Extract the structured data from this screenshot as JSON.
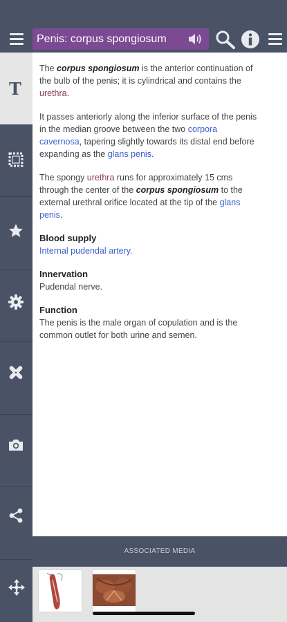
{
  "header": {
    "title": "Penis: corpus spongiosum"
  },
  "sidebar": {
    "items": [
      {
        "name": "text",
        "icon": "text-icon",
        "active": true
      },
      {
        "name": "images",
        "icon": "stamp-frame-icon",
        "active": false
      },
      {
        "name": "favorites",
        "icon": "star-icon",
        "active": false
      },
      {
        "name": "settings",
        "icon": "gear-icon",
        "active": false
      },
      {
        "name": "tools",
        "icon": "bandage-icon",
        "active": false
      },
      {
        "name": "camera",
        "icon": "camera-icon",
        "active": false
      },
      {
        "name": "share",
        "icon": "share-icon",
        "active": false
      },
      {
        "name": "move",
        "icon": "move-arrows-icon",
        "active": false
      }
    ],
    "text_glyph": "T"
  },
  "content": {
    "p1": {
      "a": "The ",
      "kw": "corpus spongiosum",
      "b": " is the anterior continuation of the bulb of the penis; it is cylindrical and contains the ",
      "link": "urethra",
      "c": "."
    },
    "p2": {
      "a": "It passes anteriorly along the inferior surface of the penis in the median groove between the two ",
      "link1": "corpora cavernosa",
      "b": ", tapering slightly towards its distal end before expanding as the ",
      "link2": "glans penis",
      "c": "."
    },
    "p3": {
      "a": "The spongy ",
      "link1": "urethra",
      "b": " runs for approximately 15 cms through the center of the ",
      "kw": "corpus spongiosum",
      "c": " to the external urethral orifice located at the tip of the ",
      "link2": "glans penis",
      "d": "."
    },
    "blood_supply": {
      "heading": "Blood supply",
      "link": "Internal pudendal artery",
      "end": "."
    },
    "innervation": {
      "heading": "Innervation",
      "text": "Pudendal nerve."
    },
    "function": {
      "heading": "Function",
      "text": "The penis is the male organ of copulation and is the common outlet for both urine and semen."
    }
  },
  "associated_media": {
    "label": "ASSOCIATED MEDIA"
  },
  "colors": {
    "chrome": "#4a5265",
    "title_bg": "#7b4a92",
    "link_blue": "#3b5fd0",
    "link_purple": "#8a3a5a"
  }
}
